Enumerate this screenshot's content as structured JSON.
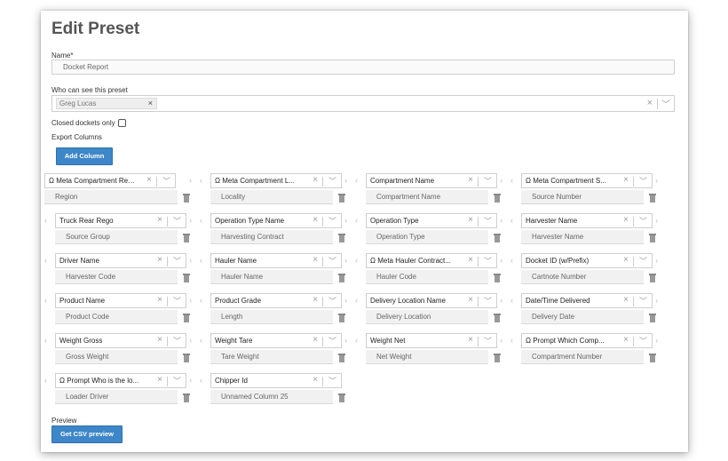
{
  "title": "Edit Preset",
  "name_label": "Name*",
  "name_value": "Docket Report",
  "who_label": "Who can see this preset",
  "who_tag": "Greg Lucas",
  "closed_label": "Closed dockets only",
  "export_label": "Export Columns",
  "add_column_label": "Add Column",
  "preview_label": "Preview",
  "csv_button_label": "Get CSV preview",
  "columns": [
    {
      "field": "Ω Meta Compartment Region",
      "alias": "Region"
    },
    {
      "field": "Ω Meta Compartment L...",
      "alias": "Locality"
    },
    {
      "field": "Compartment Name",
      "alias": "Compartment Name"
    },
    {
      "field": "Ω Meta Compartment S...",
      "alias": "Source Number"
    },
    {
      "field": "Truck Rear Rego",
      "alias": "Source Group"
    },
    {
      "field": "Operation Type Name",
      "alias": "Harvesting Contract"
    },
    {
      "field": "Operation Type",
      "alias": "Operation Type"
    },
    {
      "field": "Harvester Name",
      "alias": "Harvester Name"
    },
    {
      "field": "Driver Name",
      "alias": "Harvester Code"
    },
    {
      "field": "Hauler Name",
      "alias": "Hauler Name"
    },
    {
      "field": "Ω Meta Hauler Contract...",
      "alias": "Hauler Code"
    },
    {
      "field": "Docket ID (w/Prefix)",
      "alias": "Cartnote Number"
    },
    {
      "field": "Product Name",
      "alias": "Product Code"
    },
    {
      "field": "Product Grade",
      "alias": "Length"
    },
    {
      "field": "Delivery Location Name",
      "alias": "Delivery Location"
    },
    {
      "field": "Date/Time Delivered",
      "alias": "Delivery Date"
    },
    {
      "field": "Weight Gross",
      "alias": "Gross Weight"
    },
    {
      "field": "Weight Tare",
      "alias": "Tare Weight"
    },
    {
      "field": "Weight Net",
      "alias": "Net Weight"
    },
    {
      "field": "Ω Prompt Which Comp...",
      "alias": "Compartment Number"
    },
    {
      "field": "Ω Prompt Who is the lo...",
      "alias": "Loader Driver"
    },
    {
      "field": "Chipper Id",
      "alias": "Unnamed Column 25"
    }
  ]
}
